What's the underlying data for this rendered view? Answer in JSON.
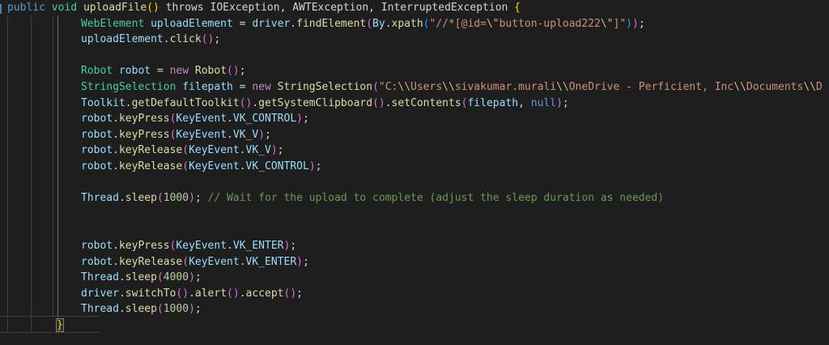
{
  "editor": {
    "background": "#1e1e1e",
    "colors": {
      "kw": "#569CD6",
      "ty": "#4EC9B0",
      "fn": "#DCDCAA",
      "va": "#9CDCFE",
      "pl": "#D4D4D4",
      "ct": "#C586C0",
      "nu": "#B5CEA8",
      "st": "#CE9178",
      "es": "#D7BA7D",
      "cm": "#6A9955",
      "b1": "#FFD700",
      "b2": "#DA70D6",
      "b3": "#179FFF"
    },
    "lines": [
      {
        "indent": 9,
        "segments": [
          [
            "public ",
            "kw"
          ],
          [
            "void ",
            "ty"
          ],
          [
            "uploadFile",
            "fn"
          ],
          [
            "()",
            "b1"
          ],
          [
            " throws IOException, AWTException, InterruptedException ",
            "pl"
          ],
          [
            "{",
            "b1"
          ]
        ]
      },
      {
        "indent": 100,
        "segments": [
          [
            "WebElement ",
            "ty"
          ],
          [
            "uploadElement ",
            "va"
          ],
          [
            "= ",
            "pl"
          ],
          [
            "driver",
            "va"
          ],
          [
            ".",
            "pl"
          ],
          [
            "findElement",
            "fn"
          ],
          [
            "(",
            "b2"
          ],
          [
            "By",
            "va"
          ],
          [
            ".",
            "pl"
          ],
          [
            "xpath",
            "fn"
          ],
          [
            "(",
            "b3"
          ],
          [
            "\"//*[@id=",
            "st"
          ],
          [
            "\\\"",
            "es"
          ],
          [
            "button-upload222",
            "st"
          ],
          [
            "\\\"",
            "es"
          ],
          [
            "]\"",
            "st"
          ],
          [
            ")",
            "b3"
          ],
          [
            ")",
            "b2"
          ],
          [
            ";",
            "pl"
          ]
        ]
      },
      {
        "indent": 100,
        "segments": [
          [
            "uploadElement",
            "va"
          ],
          [
            ".",
            "pl"
          ],
          [
            "click",
            "fn"
          ],
          [
            "()",
            "b2"
          ],
          [
            ";",
            "pl"
          ]
        ]
      },
      {
        "indent": 100,
        "segments": []
      },
      {
        "indent": 100,
        "segments": [
          [
            "Robot ",
            "ty"
          ],
          [
            "robot ",
            "va"
          ],
          [
            "= ",
            "pl"
          ],
          [
            "new ",
            "ct"
          ],
          [
            "Robot",
            "fn"
          ],
          [
            "()",
            "b2"
          ],
          [
            ";",
            "pl"
          ]
        ]
      },
      {
        "indent": 100,
        "segments": [
          [
            "StringSelection ",
            "ty"
          ],
          [
            "filepath ",
            "va"
          ],
          [
            "= ",
            "pl"
          ],
          [
            "new ",
            "ct"
          ],
          [
            "StringSelection",
            "fn"
          ],
          [
            "(",
            "b2"
          ],
          [
            "\"C:",
            "st"
          ],
          [
            "\\\\",
            "es"
          ],
          [
            "Users",
            "st"
          ],
          [
            "\\\\",
            "es"
          ],
          [
            "sivakumar.murali",
            "st"
          ],
          [
            "\\\\",
            "es"
          ],
          [
            "OneDrive - Perficient, Inc",
            "st"
          ],
          [
            "\\\\",
            "es"
          ],
          [
            "Documents",
            "st"
          ],
          [
            "\\\\",
            "es"
          ],
          [
            "D",
            "st"
          ]
        ]
      },
      {
        "indent": 100,
        "segments": [
          [
            "Toolkit",
            "va"
          ],
          [
            ".",
            "pl"
          ],
          [
            "getDefaultToolkit",
            "fn"
          ],
          [
            "()",
            "b2"
          ],
          [
            ".",
            "pl"
          ],
          [
            "getSystemClipboard",
            "fn"
          ],
          [
            "()",
            "b2"
          ],
          [
            ".",
            "pl"
          ],
          [
            "setContents",
            "fn"
          ],
          [
            "(",
            "b2"
          ],
          [
            "filepath",
            "va"
          ],
          [
            ", ",
            "pl"
          ],
          [
            "null",
            "kw"
          ],
          [
            ")",
            "b2"
          ],
          [
            ";",
            "pl"
          ]
        ]
      },
      {
        "indent": 100,
        "segments": [
          [
            "robot",
            "va"
          ],
          [
            ".",
            "pl"
          ],
          [
            "keyPress",
            "fn"
          ],
          [
            "(",
            "b2"
          ],
          [
            "KeyEvent",
            "va"
          ],
          [
            ".",
            "pl"
          ],
          [
            "VK_CONTROL",
            "va"
          ],
          [
            ")",
            "b2"
          ],
          [
            ";",
            "pl"
          ]
        ]
      },
      {
        "indent": 100,
        "segments": [
          [
            "robot",
            "va"
          ],
          [
            ".",
            "pl"
          ],
          [
            "keyPress",
            "fn"
          ],
          [
            "(",
            "b2"
          ],
          [
            "KeyEvent",
            "va"
          ],
          [
            ".",
            "pl"
          ],
          [
            "VK_V",
            "va"
          ],
          [
            ")",
            "b2"
          ],
          [
            ";",
            "pl"
          ]
        ]
      },
      {
        "indent": 100,
        "segments": [
          [
            "robot",
            "va"
          ],
          [
            ".",
            "pl"
          ],
          [
            "keyRelease",
            "fn"
          ],
          [
            "(",
            "b2"
          ],
          [
            "KeyEvent",
            "va"
          ],
          [
            ".",
            "pl"
          ],
          [
            "VK_V",
            "va"
          ],
          [
            ")",
            "b2"
          ],
          [
            ";",
            "pl"
          ]
        ]
      },
      {
        "indent": 100,
        "segments": [
          [
            "robot",
            "va"
          ],
          [
            ".",
            "pl"
          ],
          [
            "keyRelease",
            "fn"
          ],
          [
            "(",
            "b2"
          ],
          [
            "KeyEvent",
            "va"
          ],
          [
            ".",
            "pl"
          ],
          [
            "VK_CONTROL",
            "va"
          ],
          [
            ")",
            "b2"
          ],
          [
            ";",
            "pl"
          ]
        ]
      },
      {
        "indent": 100,
        "segments": []
      },
      {
        "indent": 100,
        "segments": [
          [
            "Thread",
            "va"
          ],
          [
            ".",
            "pl"
          ],
          [
            "sleep",
            "fn"
          ],
          [
            "(",
            "b2"
          ],
          [
            "1000",
            "nu"
          ],
          [
            ")",
            "b2"
          ],
          [
            "; ",
            "pl"
          ],
          [
            "// Wait for the upload to complete (adjust the sleep duration as needed)",
            "cm"
          ]
        ]
      },
      {
        "indent": 100,
        "segments": []
      },
      {
        "indent": 100,
        "segments": []
      },
      {
        "indent": 100,
        "segments": [
          [
            "robot",
            "va"
          ],
          [
            ".",
            "pl"
          ],
          [
            "keyPress",
            "fn"
          ],
          [
            "(",
            "b2"
          ],
          [
            "KeyEvent",
            "va"
          ],
          [
            ".",
            "pl"
          ],
          [
            "VK_ENTER",
            "va"
          ],
          [
            ")",
            "b2"
          ],
          [
            ";",
            "pl"
          ]
        ]
      },
      {
        "indent": 100,
        "segments": [
          [
            "robot",
            "va"
          ],
          [
            ".",
            "pl"
          ],
          [
            "keyRelease",
            "fn"
          ],
          [
            "(",
            "b2"
          ],
          [
            "KeyEvent",
            "va"
          ],
          [
            ".",
            "pl"
          ],
          [
            "VK_ENTER",
            "va"
          ],
          [
            ")",
            "b2"
          ],
          [
            ";",
            "pl"
          ]
        ]
      },
      {
        "indent": 100,
        "segments": [
          [
            "Thread",
            "va"
          ],
          [
            ".",
            "pl"
          ],
          [
            "sleep",
            "fn"
          ],
          [
            "(",
            "b2"
          ],
          [
            "4000",
            "nu"
          ],
          [
            ")",
            "b2"
          ],
          [
            ";",
            "pl"
          ]
        ]
      },
      {
        "indent": 100,
        "segments": [
          [
            "driver",
            "va"
          ],
          [
            ".",
            "pl"
          ],
          [
            "switchTo",
            "fn"
          ],
          [
            "()",
            "b2"
          ],
          [
            ".",
            "pl"
          ],
          [
            "alert",
            "fn"
          ],
          [
            "()",
            "b2"
          ],
          [
            ".",
            "pl"
          ],
          [
            "accept",
            "fn"
          ],
          [
            "()",
            "b2"
          ],
          [
            ";",
            "pl"
          ]
        ]
      },
      {
        "indent": 100,
        "segments": [
          [
            "Thread",
            "va"
          ],
          [
            ".",
            "pl"
          ],
          [
            "sleep",
            "fn"
          ],
          [
            "(",
            "b2"
          ],
          [
            "1000",
            "nu"
          ],
          [
            ")",
            "b2"
          ],
          [
            ";",
            "pl"
          ]
        ]
      },
      {
        "indent": 70,
        "segments": [
          [
            "}",
            "b1",
            "bracket-match"
          ]
        ]
      }
    ]
  }
}
